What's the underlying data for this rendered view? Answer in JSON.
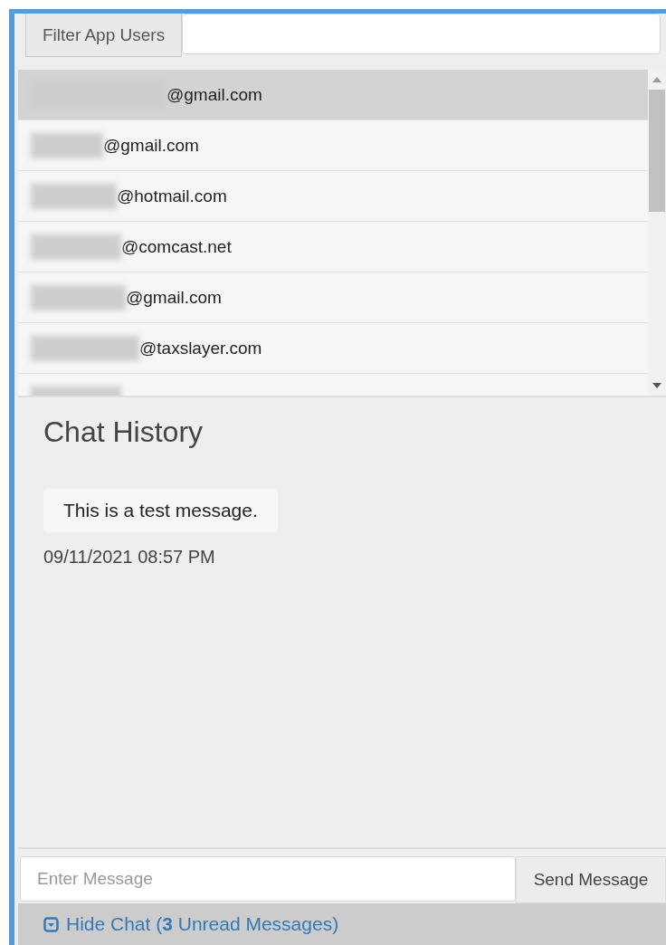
{
  "filter": {
    "label": "Filter App Users"
  },
  "users": [
    {
      "email": "@gmail.com",
      "selected": true
    },
    {
      "email": "@gmail.com",
      "selected": false
    },
    {
      "email": "@hotmail.com",
      "selected": false
    },
    {
      "email": "@comcast.net",
      "selected": false
    },
    {
      "email": "@gmail.com",
      "selected": false
    },
    {
      "email": "@taxslayer.com",
      "selected": false
    }
  ],
  "chat": {
    "title": "Chat History",
    "messages": [
      {
        "text": "This is a test message.",
        "time": "09/11/2021 08:57 PM"
      }
    ]
  },
  "composer": {
    "placeholder": "Enter Message",
    "send": "Send Message"
  },
  "toggle": {
    "label": "Hide Chat (**3** Unread Messages)"
  }
}
